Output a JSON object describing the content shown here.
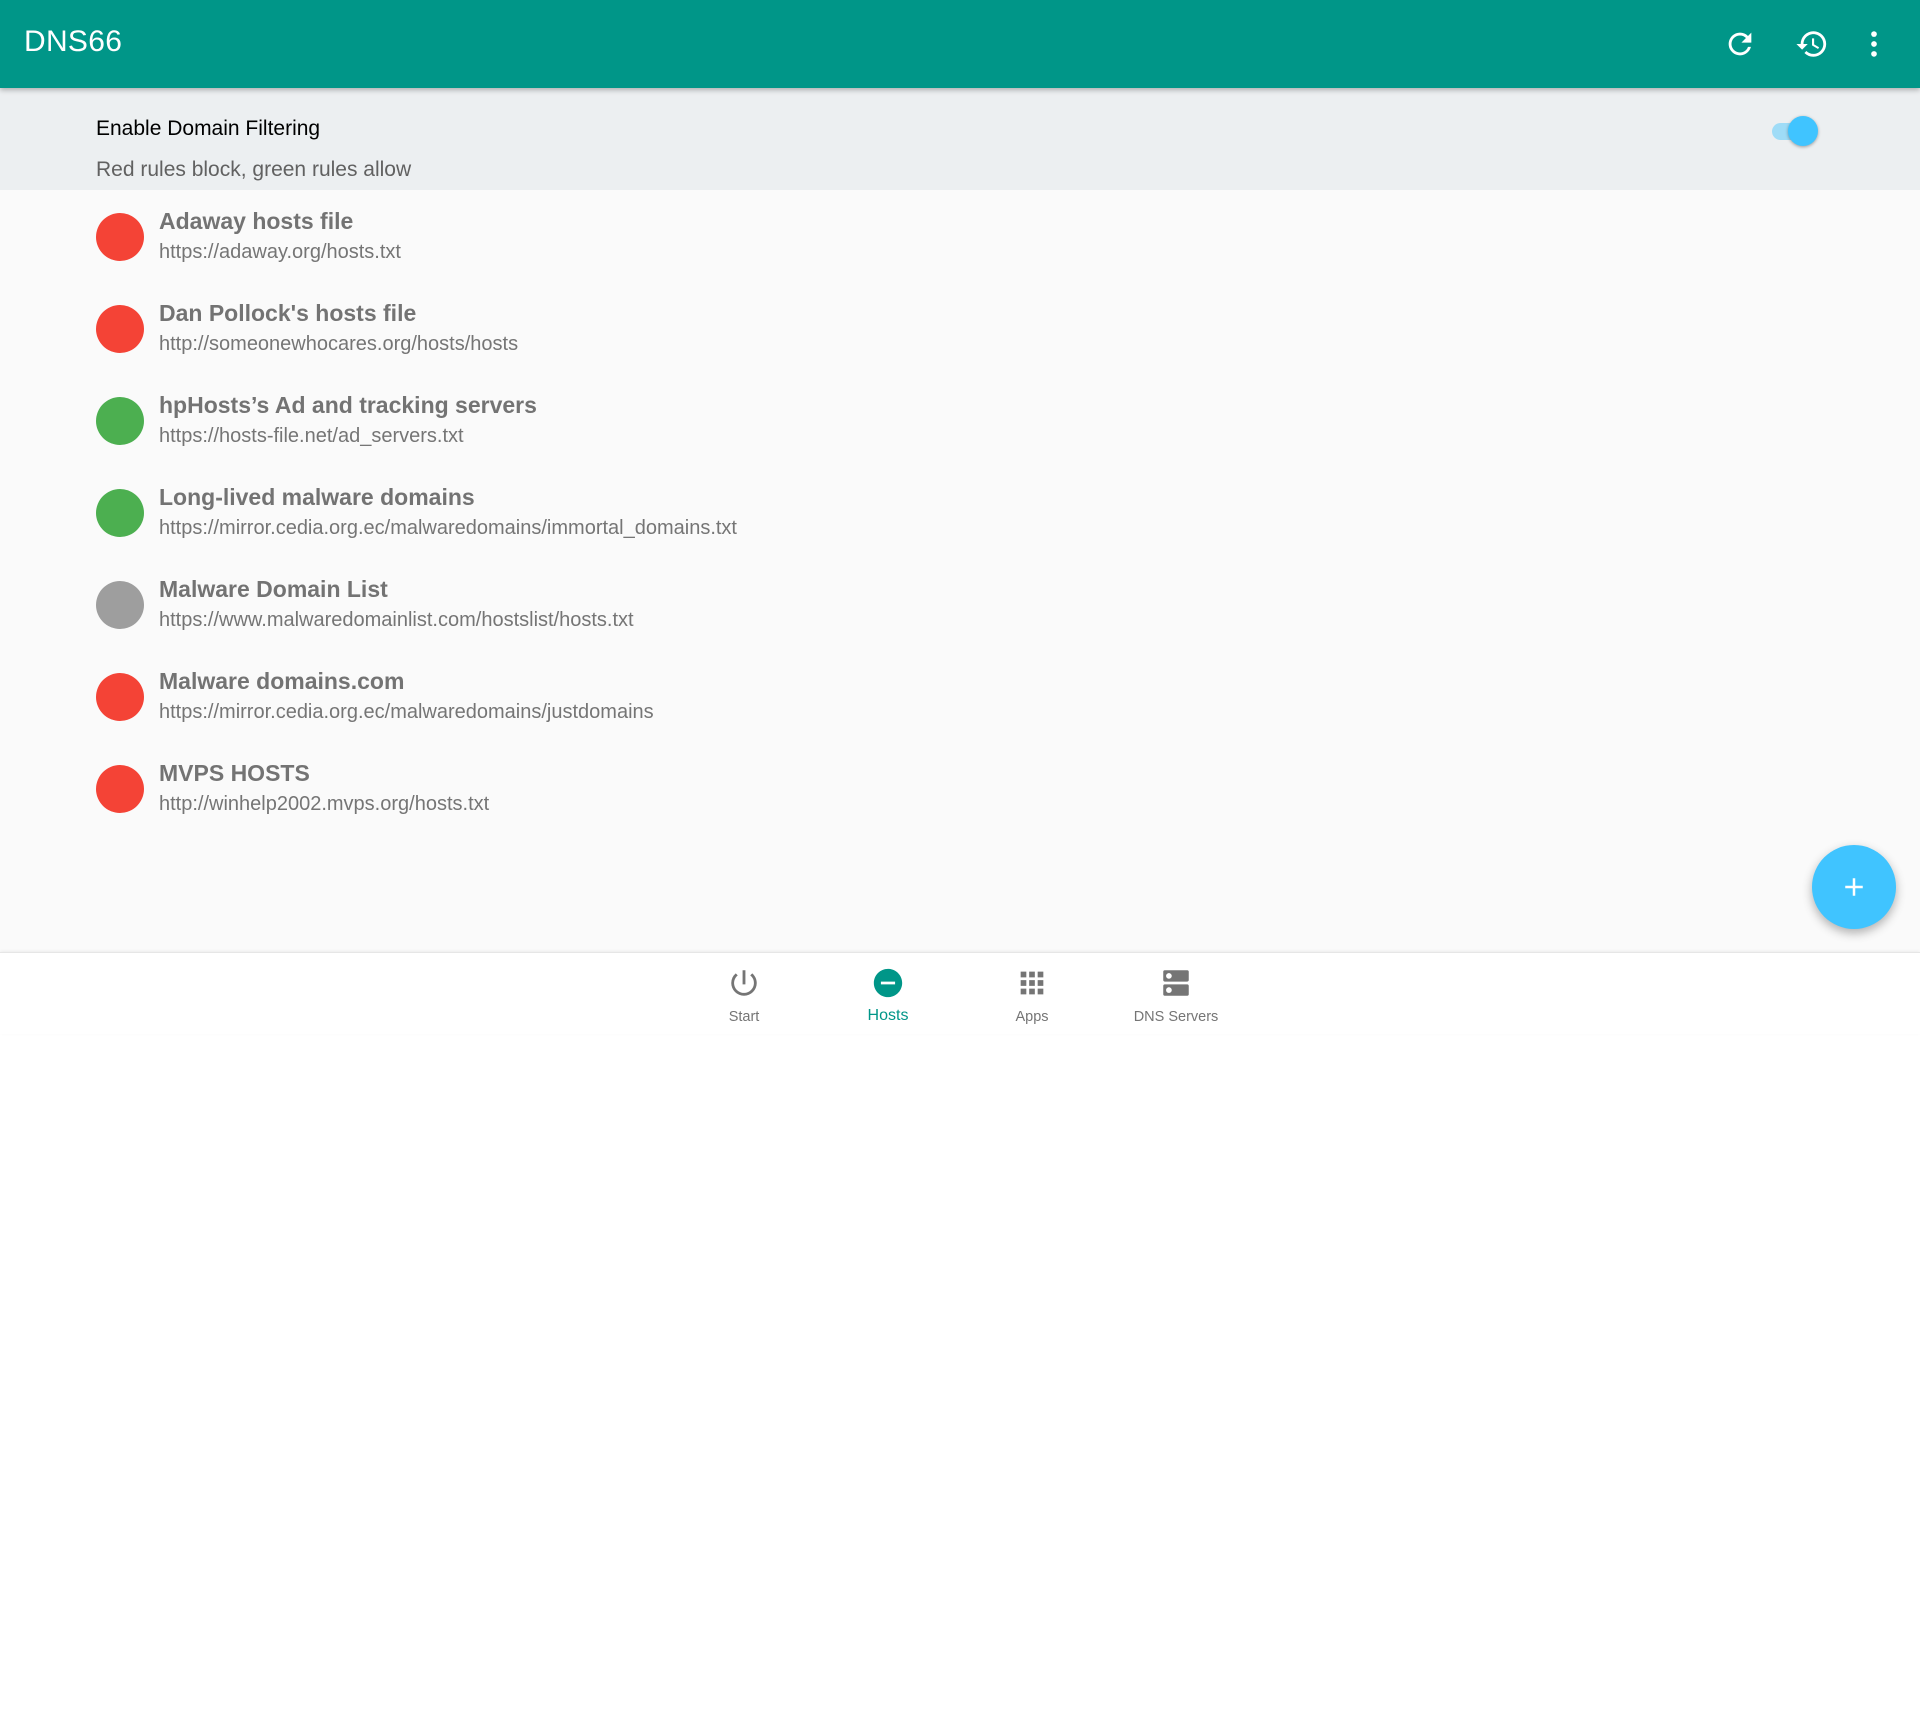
{
  "app_bar": {
    "title": "DNS66",
    "actions": [
      {
        "name": "refresh",
        "icon": "refresh-icon"
      },
      {
        "name": "history",
        "icon": "history-icon"
      },
      {
        "name": "more",
        "icon": "more-vert-icon"
      }
    ]
  },
  "filter": {
    "title": "Enable Domain Filtering",
    "subtitle": "Red rules block, green rules allow",
    "enabled": true
  },
  "hosts": [
    {
      "title": "Adaway hosts file",
      "url": "https://adaway.org/hosts.txt",
      "state": "deny",
      "color": "#f44336"
    },
    {
      "title": "Dan Pollock's hosts file",
      "url": "http://someonewhocares.org/hosts/hosts",
      "state": "deny",
      "color": "#f44336"
    },
    {
      "title": "hpHosts’s Ad and tracking servers",
      "url": "https://hosts-file.net/ad_servers.txt",
      "state": "allow",
      "color": "#4caf50"
    },
    {
      "title": "Long-lived malware domains",
      "url": "https://mirror.cedia.org.ec/malwaredomains/immortal_domains.txt",
      "state": "allow",
      "color": "#4caf50"
    },
    {
      "title": "Malware Domain List",
      "url": "https://www.malwaredomainlist.com/hostslist/hosts.txt",
      "state": "ignore",
      "color": "#9e9e9e"
    },
    {
      "title": "Malware domains.com",
      "url": "https://mirror.cedia.org.ec/malwaredomains/justdomains",
      "state": "deny",
      "color": "#f44336"
    },
    {
      "title": "MVPS HOSTS",
      "url": "http://winhelp2002.mvps.org/hosts.txt",
      "state": "deny",
      "color": "#f44336"
    }
  ],
  "fab": {
    "icon": "plus-icon"
  },
  "bottom_nav": {
    "items": [
      {
        "label": "Start",
        "icon": "power-icon",
        "active": false
      },
      {
        "label": "Hosts",
        "icon": "remove-circle-icon",
        "active": true
      },
      {
        "label": "Apps",
        "icon": "apps-grid-icon",
        "active": false
      },
      {
        "label": "DNS Servers",
        "icon": "dns-servers-icon",
        "active": false
      }
    ]
  },
  "colors": {
    "primary": "#009688",
    "accent": "#40c4ff",
    "deny": "#f44336",
    "allow": "#4caf50",
    "ignore": "#9e9e9e"
  }
}
